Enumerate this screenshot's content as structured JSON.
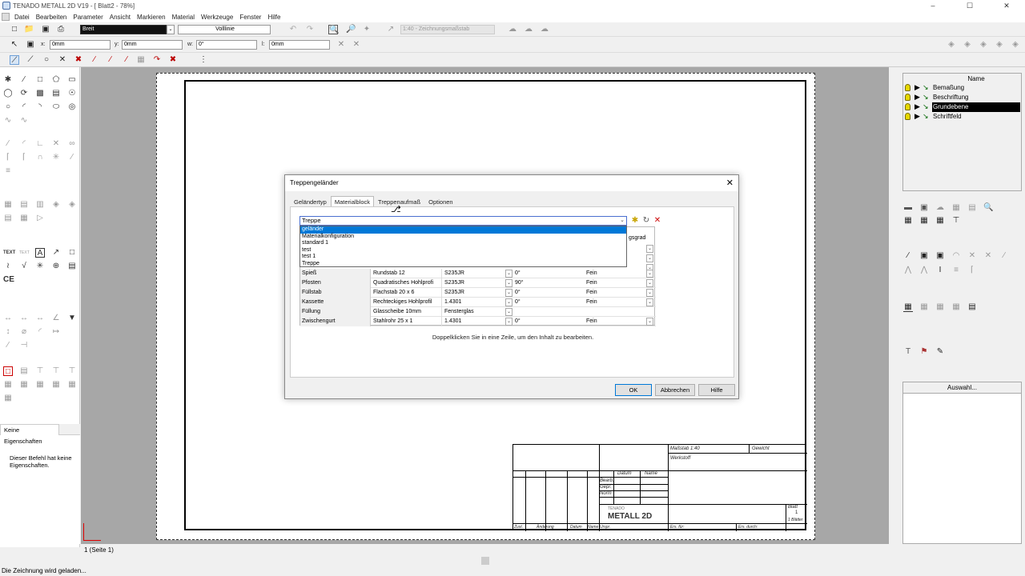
{
  "window": {
    "title": "TENADO METALL 2D V19 - [ Blatt2 - 78%]",
    "min": "–",
    "max": "☐",
    "close": "✕"
  },
  "menu": [
    "Datei",
    "Bearbeiten",
    "Parameter",
    "Ansicht",
    "Markieren",
    "Material",
    "Werkzeuge",
    "Fenster",
    "Hilfe"
  ],
  "toolbar": {
    "pen": "Breit",
    "line": "Volllinie",
    "scale": "1:40 - Zeichnungsmaßstab"
  },
  "coords": {
    "x_label": "x:",
    "x": "0mm",
    "y_label": "y:",
    "y": "0mm",
    "w_label": "w:",
    "w": "0°",
    "l_label": "l:",
    "l": "0mm"
  },
  "layers": {
    "header": "Name",
    "items": [
      {
        "name": "Bemaßung",
        "selected": false
      },
      {
        "name": "Beschriftung",
        "selected": false
      },
      {
        "name": "Grundebene",
        "selected": true
      },
      {
        "name": "Schriftfeld",
        "selected": false
      }
    ]
  },
  "selection": {
    "header": "Auswahl..."
  },
  "props": {
    "tab": "Keine Eigenschaften",
    "text": "Dieser Befehl hat keine Eigenschaften."
  },
  "page": {
    "tab": "1 (Seite 1)"
  },
  "status": {
    "text": "Die Zeichnung wird geladen..."
  },
  "titleblock": {
    "massstab": "Maßstab 1:40",
    "gewicht": "Gewicht",
    "werkstoff": "Werkstoff",
    "datum": "Datum",
    "name": "Name",
    "bearb": "Bearb.",
    "gepr": "Gepr.",
    "norm": "Norm",
    "brand_top": "TENADO",
    "brand": "METALL 2D",
    "blatt": "Blatt",
    "blatt_n": "1",
    "blaetter": "1 Blätter",
    "zust": "Zust.",
    "aenderung": "Änderung",
    "datum2": "Datum",
    "name2": "Name",
    "urspr": "Urspr.",
    "ersfuer": "Ers. für:",
    "ersdurch": "Ers. durch:"
  },
  "dialog": {
    "title": "Treppengeländer",
    "close": "✕",
    "tabs": [
      "Geländertyp",
      "Materialblock",
      "Treppenaufmaß",
      "Optionen"
    ],
    "active_tab": 1,
    "combo_value": "Treppe",
    "dropdown": [
      "geländer",
      "Materialkonfiguration",
      "standard 1",
      "test",
      "test 1",
      "Treppe"
    ],
    "dropdown_highlight": 0,
    "grid_header_partial": "gsgrad",
    "rows": [
      {
        "name": "Spieß",
        "profile": "Rundstab 12",
        "material": "S235JR",
        "angle": "0°",
        "finish": "Fein"
      },
      {
        "name": "Pfosten",
        "profile": "Quadratisches Hohlprofi",
        "material": "S235JR",
        "angle": "90°",
        "finish": "Fein"
      },
      {
        "name": "Füllstab",
        "profile": "Flachstab 20 x 6",
        "material": "S235JR",
        "angle": "0°",
        "finish": "Fein"
      },
      {
        "name": "Kassette",
        "profile": "Rechteckiges Hohlprofil",
        "material": "1.4301",
        "angle": "0°",
        "finish": "Fein"
      },
      {
        "name": "Füllung",
        "profile": "Glasscheibe 10mm",
        "material": "Fensterglas",
        "angle": "",
        "finish": ""
      },
      {
        "name": "Zwischengurt",
        "profile": "Stahlrohr 25 x 1",
        "material": "1.4301",
        "angle": "0°",
        "finish": "Fein"
      }
    ],
    "hint": "Doppelklicken Sie in eine Zeile, um den Inhalt zu bearbeiten.",
    "ok": "OK",
    "cancel": "Abbrechen",
    "help": "Hilfe"
  }
}
